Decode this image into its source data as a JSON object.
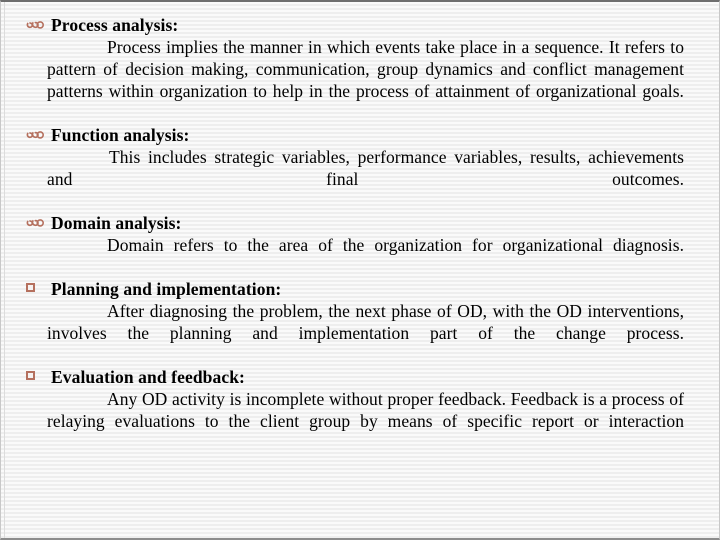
{
  "slide": {
    "background_color": "#f4f4f4",
    "bullet_color": "#b5705e",
    "text_color": "#000000",
    "sections": [
      {
        "bullet": "fleuron-bullet-icon",
        "heading": "Process analysis:",
        "body": "Process implies the manner in which events take place in a sequence. It refers to pattern of decision making, communication, group dynamics and conflict management patterns within organization to help in the process of attainment of organizational goals."
      },
      {
        "bullet": "fleuron-bullet-icon",
        "heading": "Function analysis:",
        "body": "This includes strategic variables, performance variables, results, achievements and final outcomes."
      },
      {
        "bullet": "fleuron-bullet-icon",
        "heading": "Domain analysis:",
        "body": "Domain refers to the area of the organization for organizational diagnosis."
      },
      {
        "bullet": "square-bullet-icon",
        "heading": "Planning and implementation:",
        "body": "After diagnosing the problem, the next phase of OD, with the OD interventions, involves the planning and implementation part of the change process."
      },
      {
        "bullet": "square-bullet-icon",
        "heading": "Evaluation and feedback:",
        "body": "Any OD activity is incomplete without proper feedback. Feedback is a process of relaying evaluations to the client group by means of specific report or interaction"
      }
    ]
  }
}
